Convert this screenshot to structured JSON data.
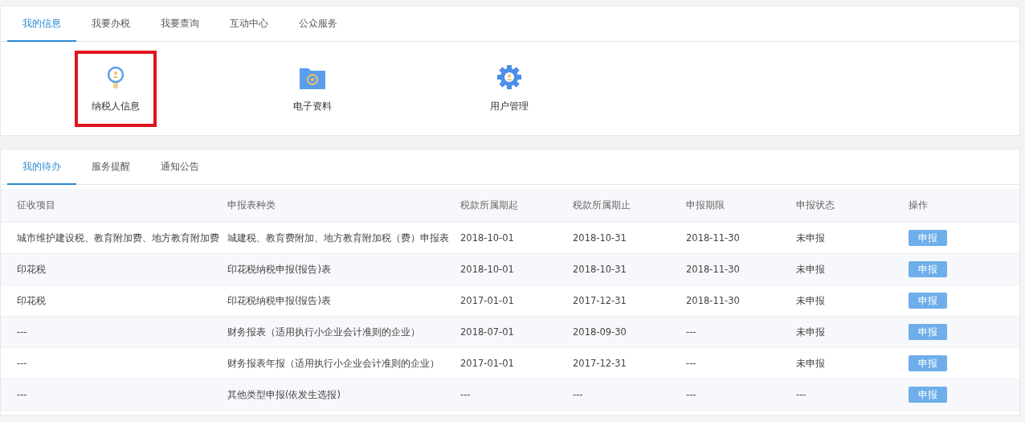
{
  "top_tabs": [
    {
      "label": "我的信息",
      "selected": true
    },
    {
      "label": "我要办税",
      "selected": false
    },
    {
      "label": "我要查询",
      "selected": false
    },
    {
      "label": "互动中心",
      "selected": false
    },
    {
      "label": "公众服务",
      "selected": false
    }
  ],
  "tiles": [
    {
      "kind": "badge",
      "label": "纳税人信息",
      "highlighted": true
    },
    {
      "kind": "folder",
      "label": "电子资料",
      "highlighted": false
    },
    {
      "kind": "gear",
      "label": "用户管理",
      "highlighted": false
    }
  ],
  "bottom_tabs": [
    {
      "label": "我的待办",
      "selected": true
    },
    {
      "label": "服务提醒",
      "selected": false
    },
    {
      "label": "通知公告",
      "selected": false
    }
  ],
  "table": {
    "columns": [
      "征收项目",
      "申报表种类",
      "税款所属期起",
      "税款所属期止",
      "申报期限",
      "申报状态",
      "操作"
    ],
    "rows": [
      {
        "cells": [
          "城市维护建设税、教育附加费、地方教育附加费",
          "城建税、教育费附加、地方教育附加税（费）申报表",
          "2018-10-01",
          "2018-10-31",
          "2018-11-30",
          "未申报"
        ],
        "action": "申报"
      },
      {
        "cells": [
          "印花税",
          "印花税纳税申报(报告)表",
          "2018-10-01",
          "2018-10-31",
          "2018-11-30",
          "未申报"
        ],
        "action": "申报"
      },
      {
        "cells": [
          "印花税",
          "印花税纳税申报(报告)表",
          "2017-01-01",
          "2017-12-31",
          "2018-11-30",
          "未申报"
        ],
        "action": "申报"
      },
      {
        "cells": [
          "---",
          "财务报表（适用执行小企业会计准则的企业）",
          "2018-07-01",
          "2018-09-30",
          "---",
          "未申报"
        ],
        "action": "申报"
      },
      {
        "cells": [
          "---",
          "财务报表年报（适用执行小企业会计准则的企业）",
          "2017-01-01",
          "2017-12-31",
          "---",
          "未申报"
        ],
        "action": "申报"
      },
      {
        "cells": [
          "---",
          "其他类型申报(依发生选报)",
          "---",
          "---",
          "---",
          "---"
        ],
        "action": "申报"
      }
    ]
  }
}
